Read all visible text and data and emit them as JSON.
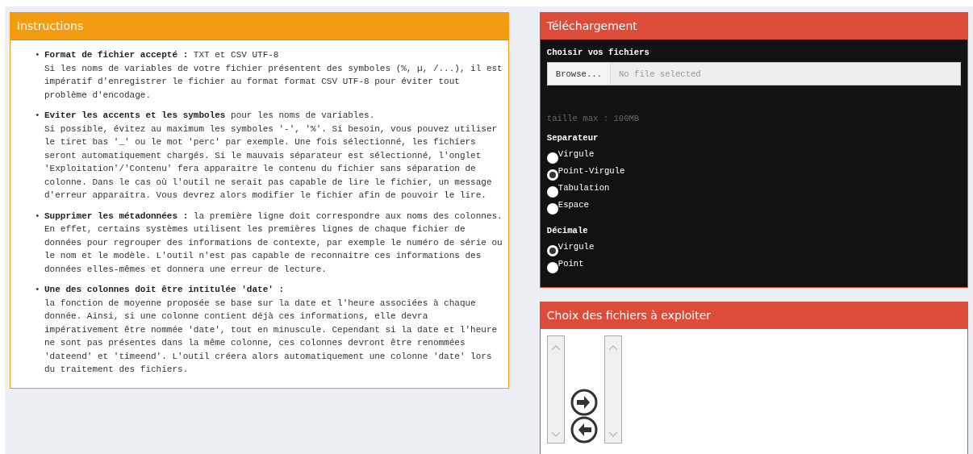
{
  "instructions": {
    "title": "Instructions",
    "items": [
      {
        "marker": "•",
        "text": "**Format de fichier accepté :** TXT et CSV UTF-8\nSi les noms de variables de votre fichier présentent des symboles (%, µ, /...), il est impératif d'enregistrer le fichier au format format CSV UTF-8 pour éviter tout problème d'encodage."
      },
      {
        "marker": "•",
        "text": "**Eviter les accents et les symboles** pour les noms de variables.\nSi possible, évitez au maximum les symboles '-', '%'. Si besoin, vous pouvez utiliser le tiret bas '_' ou le mot 'perc' par exemple. Une fois sélectionné, les fichiers seront automatiquement chargés. Si le mauvais séparateur est sélectionné, l'onglet 'Exploitation'/'Contenu' fera apparaitre le contenu du fichier sans séparation de colonne. Dans le cas où l'outil ne serait pas capable de lire le fichier, un message d'erreur apparaitra. Vous devrez alors modifier le fichier afin de pouvoir le lire."
      },
      {
        "marker": "•",
        "text": "**Supprimer les métadonnées :** la première ligne doit correspondre aux noms des colonnes. En effet, certains systèmes utilisent les premières lignes de chaque fichier de données pour regrouper des informations de contexte, par exemple le numéro de série ou le nom et le modèle. L'outil n'est pas capable de reconnaitre ces informations des données elles-mêmes et donnera une erreur de lecture."
      },
      {
        "marker": "•",
        "text": "**Une des colonnes doit être intitulée 'date' :**\nla fonction de moyenne proposée se base sur la date et l'heure associées à chaque donnée. Ainsi, si une colonne contient déjà ces informations, elle devra impérativement être nommée 'date', tout en minuscule. Cependant si la date et l'heure ne sont pas présentes dans la même colonne, ces colonnes devront être renommées 'dateend' et 'timeend'. L'outil créera alors automatiquement une colonne 'date' lors du traitement des fichiers."
      }
    ]
  },
  "upload": {
    "title": "Téléchargement",
    "file_label": "Choisir vos fichiers",
    "browse_button": "Browse...",
    "file_field": {
      "placeholder": "No file selected"
    },
    "max_size": "taille max : 100MB",
    "separator": {
      "label": "Separateur",
      "options": [
        {
          "label": "Virgule",
          "selected": false
        },
        {
          "label": "Point-Virgule",
          "selected": true
        },
        {
          "label": "Tabulation",
          "selected": false
        },
        {
          "label": "Espace",
          "selected": false
        }
      ]
    },
    "decimal": {
      "label": "Décimale",
      "options": [
        {
          "label": "Virgule",
          "selected": true
        },
        {
          "label": "Point",
          "selected": false
        }
      ]
    }
  },
  "file_choice": {
    "title": "Choix des fichiers à exploiter"
  }
}
